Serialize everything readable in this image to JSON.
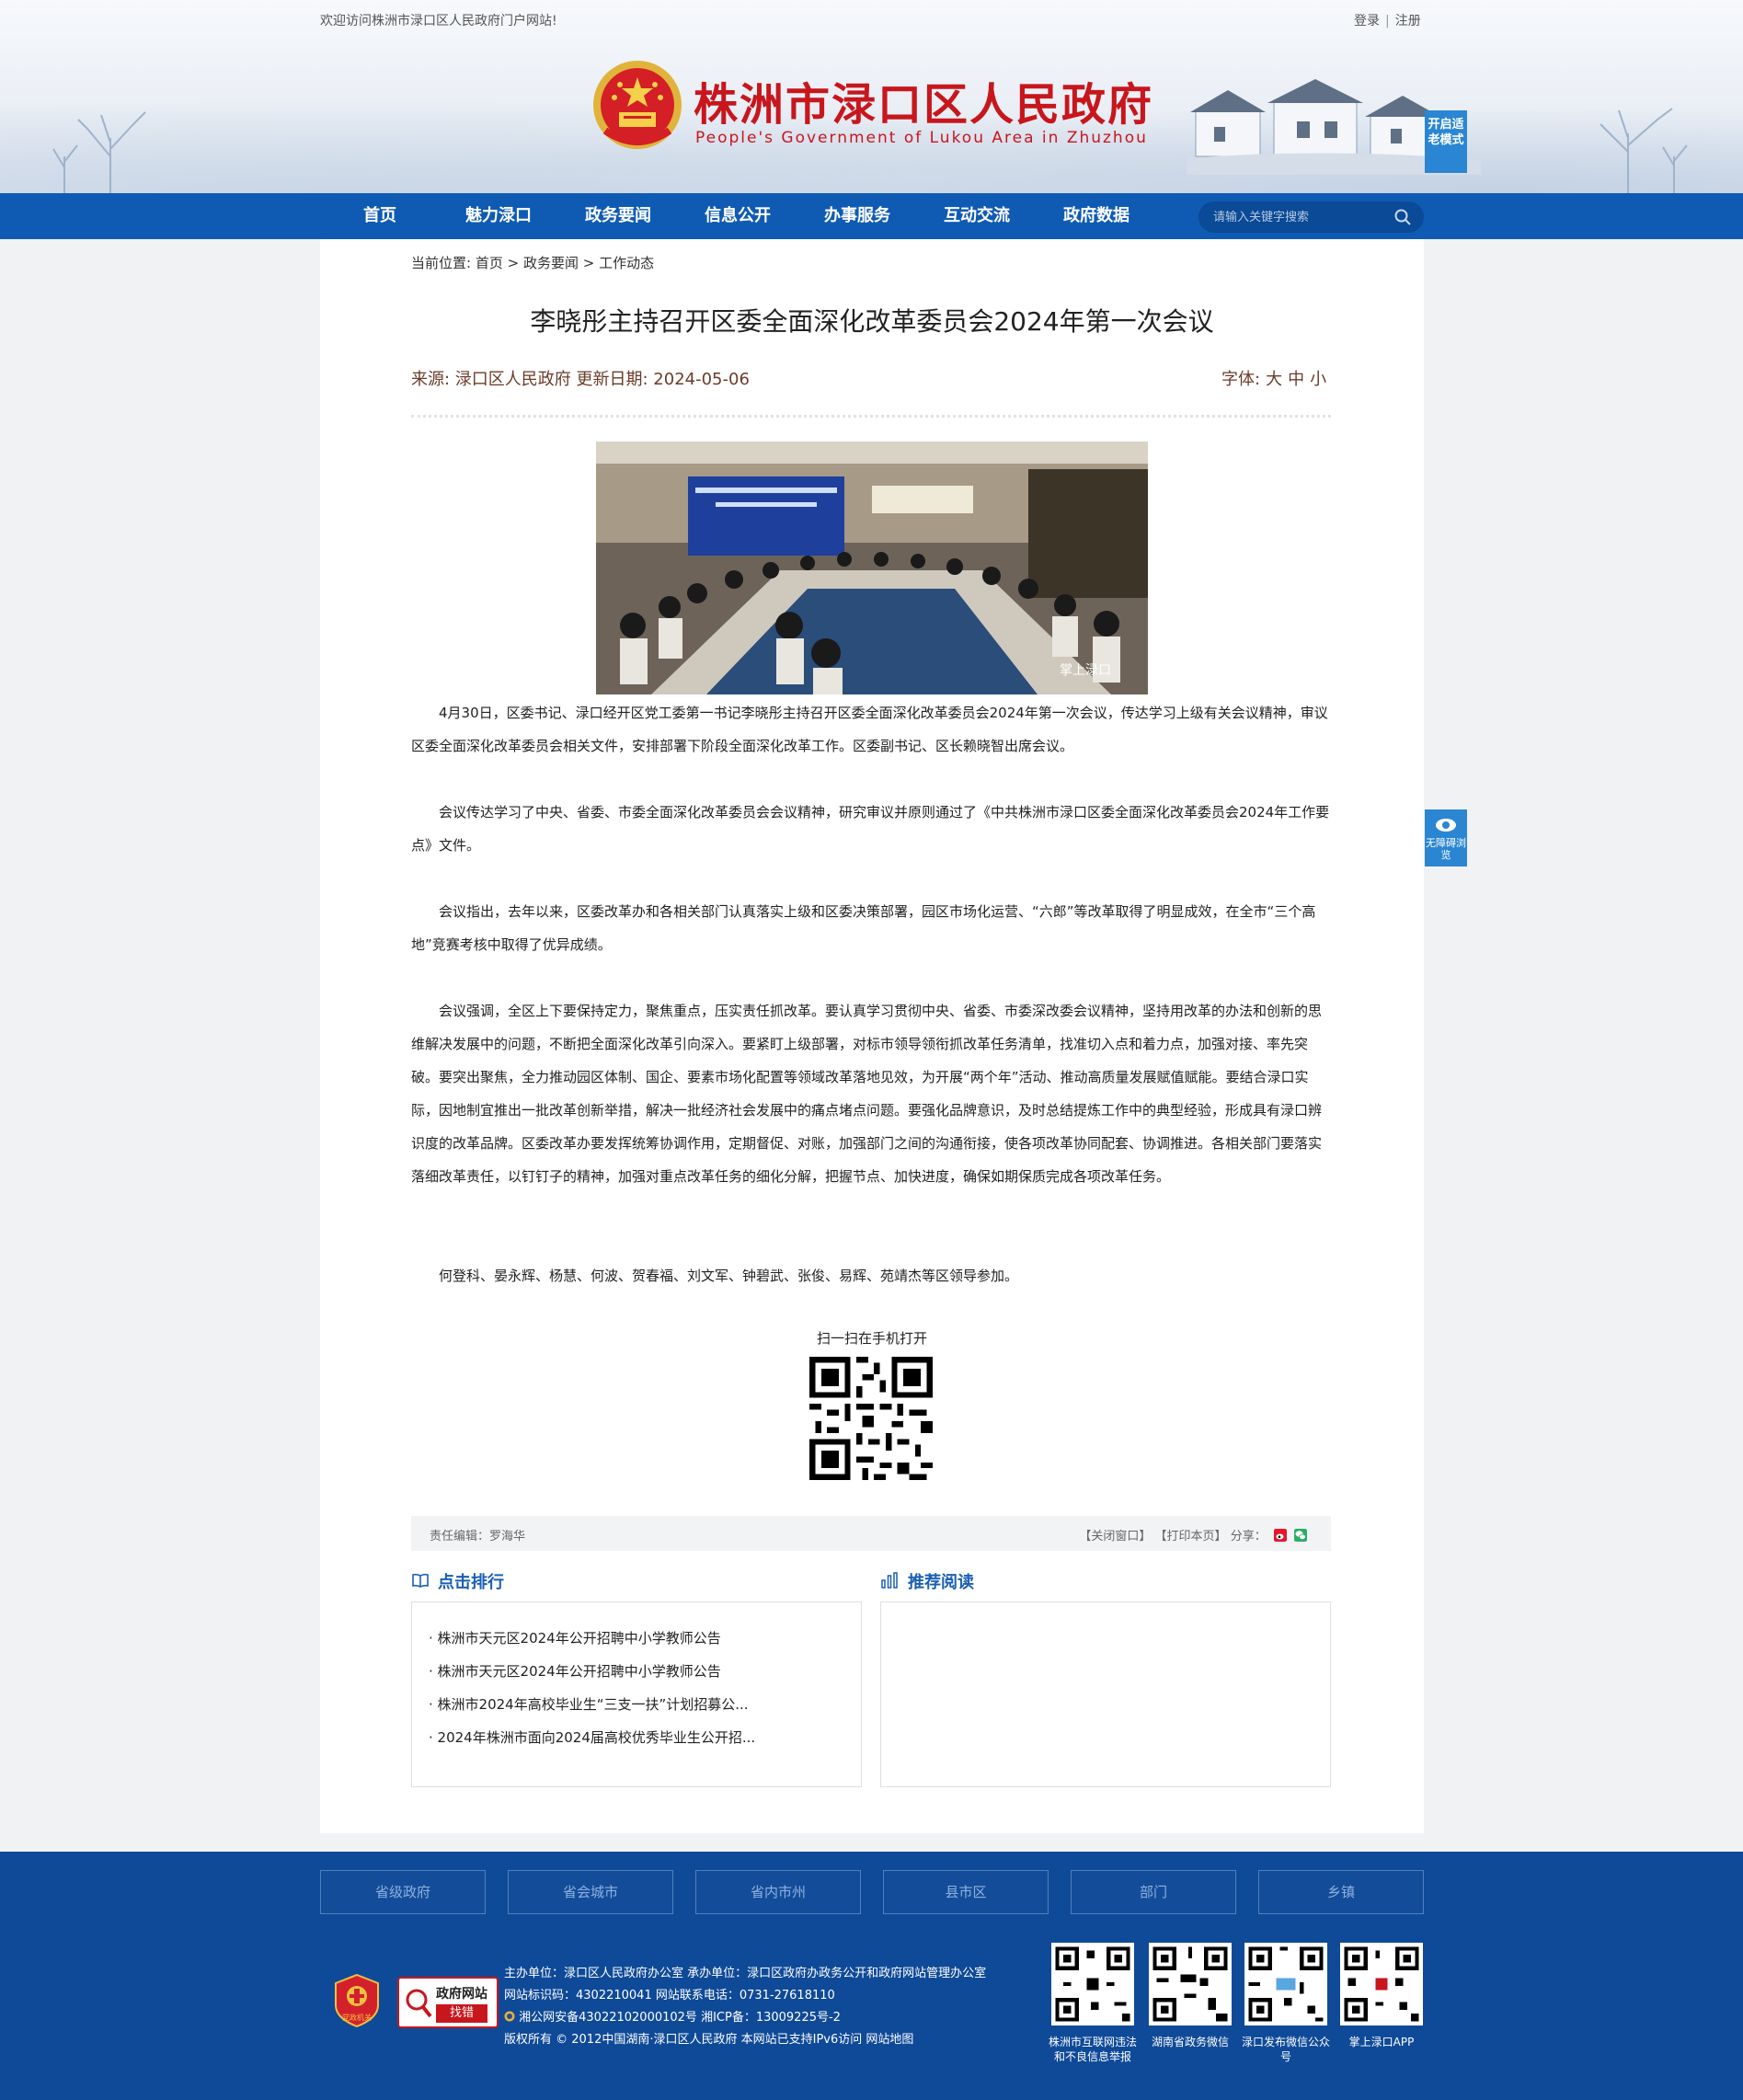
{
  "header": {
    "welcome": "欢迎访问株洲市渌口区人民政府门户网站!",
    "login": "登录",
    "register": "注册",
    "site_title": "株洲市渌口区人民政府",
    "site_subtitle": "People's Government of Lukou Area in Zhuzhou",
    "elder_mode": "开启适老模式"
  },
  "nav": {
    "items": [
      "首页",
      "魅力渌口",
      "政务要闻",
      "信息公开",
      "办事服务",
      "互动交流",
      "政府数据"
    ],
    "search_placeholder": "请输入关键字搜索"
  },
  "breadcrumb": {
    "prefix": "当前位置:",
    "items": [
      "首页",
      "政务要闻",
      "工作动态"
    ],
    "sep": ">"
  },
  "article": {
    "title": "李晓彤主持召开区委全面深化改革委员会2024年第一次会议",
    "meta": "来源:  渌口区人民政府 更新日期:  2024-05-06",
    "font_label": "字体:",
    "font_sizes": [
      "大",
      "中",
      "小"
    ],
    "photo_screen_text": "中共株洲市渌口区委全面深化改革委员会2024年第一次会议",
    "photo_watermark": "掌上渌口",
    "paragraphs": [
      "4月30日，区委书记、渌口经开区党工委第一书记李晓彤主持召开区委全面深化改革委员会2024年第一次会议，传达学习上级有关会议精神，审议区委全面深化改革委员会相关文件，安排部署下阶段全面深化改革工作。区委副书记、区长赖晓智出席会议。",
      "会议传达学习了中央、省委、市委全面深化改革委员会会议精神，研究审议并原则通过了《中共株洲市渌口区委全面深化改革委员会2024年工作要点》文件。",
      "会议指出，去年以来，区委改革办和各相关部门认真落实上级和区委决策部署，园区市场化运营、“六郎”等改革取得了明显成效，在全市“三个高地”竞赛考核中取得了优异成绩。",
      "会议强调，全区上下要保持定力，聚焦重点，压实责任抓改革。要认真学习贯彻中央、省委、市委深改委会议精神，坚持用改革的办法和创新的思维解决发展中的问题，不断把全面深化改革引向深入。要紧盯上级部署，对标市领导领衔抓改革任务清单，找准切入点和着力点，加强对接、率先突破。要突出聚焦，全力推动园区体制、国企、要素市场化配置等领域改革落地见效，为开展“两个年”活动、推动高质量发展赋值赋能。要结合渌口实际，因地制宜推出一批改革创新举措，解决一批经济社会发展中的痛点堵点问题。要强化品牌意识，及时总结提炼工作中的典型经验，形成具有渌口辨识度的改革品牌。区委改革办要发挥统筹协调作用，定期督促、对账，加强部门之间的沟通衔接，使各项改革协同配套、协调推进。各相关部门要落实落细改革责任，以钉钉子的精神，加强对重点改革任务的细化分解，把握节点、加快进度，确保如期保质完成各项改革任务。",
      "何登科、晏永辉、杨慧、何波、贺春福、刘文军、钟碧武、张俊、易辉、苑靖杰等区领导参加。"
    ],
    "qr_label": "扫一扫在手机打开"
  },
  "article_bar": {
    "editor": "责任编辑：罗海华",
    "close": "【关闭窗口】",
    "print": "【打印本页】",
    "share": "分享："
  },
  "ranking": {
    "title": "点击排行",
    "items": [
      "株洲市天元区2024年公开招聘中小学教师公告",
      "株洲市天元区2024年公开招聘中小学教师公告",
      "株洲市2024年高校毕业生“三支一扶”计划招募公...",
      "2024年株洲市面向2024届高校优秀毕业生公开招..."
    ]
  },
  "recommend": {
    "title": "推荐阅读"
  },
  "float": {
    "accessibility": "无障碍浏览"
  },
  "footer": {
    "links": [
      "省级政府",
      "省会城市",
      "省内市州",
      "县市区",
      "部门",
      "乡镇"
    ],
    "badge_party": "党政机关",
    "badge_error_top": "政府网站",
    "badge_error_bottom": "找错",
    "info": [
      "主办单位：渌口区人民政府办公室 承办单位：渌口区政府办政务公开和政府网站管理办公室",
      "网站标识码：4302210041 网站联系电话：0731-27618110",
      "湘公网安备43022102000102号 湘ICP备：13009225号-2",
      "版权所有 © 2012中国湖南·渌口区人民政府 本网站已支持IPv6访问 网站地图"
    ],
    "qrs": [
      "株洲市互联网违法和不良信息举报",
      "湖南省政务微信",
      "渌口发布微信公众号",
      "掌上渌口APP"
    ]
  },
  "colors": {
    "brand_blue": "#0f5bb4",
    "title_red": "#c8161d",
    "footer_blue": "#0f4a98",
    "accent_blue": "#2a86d2"
  }
}
